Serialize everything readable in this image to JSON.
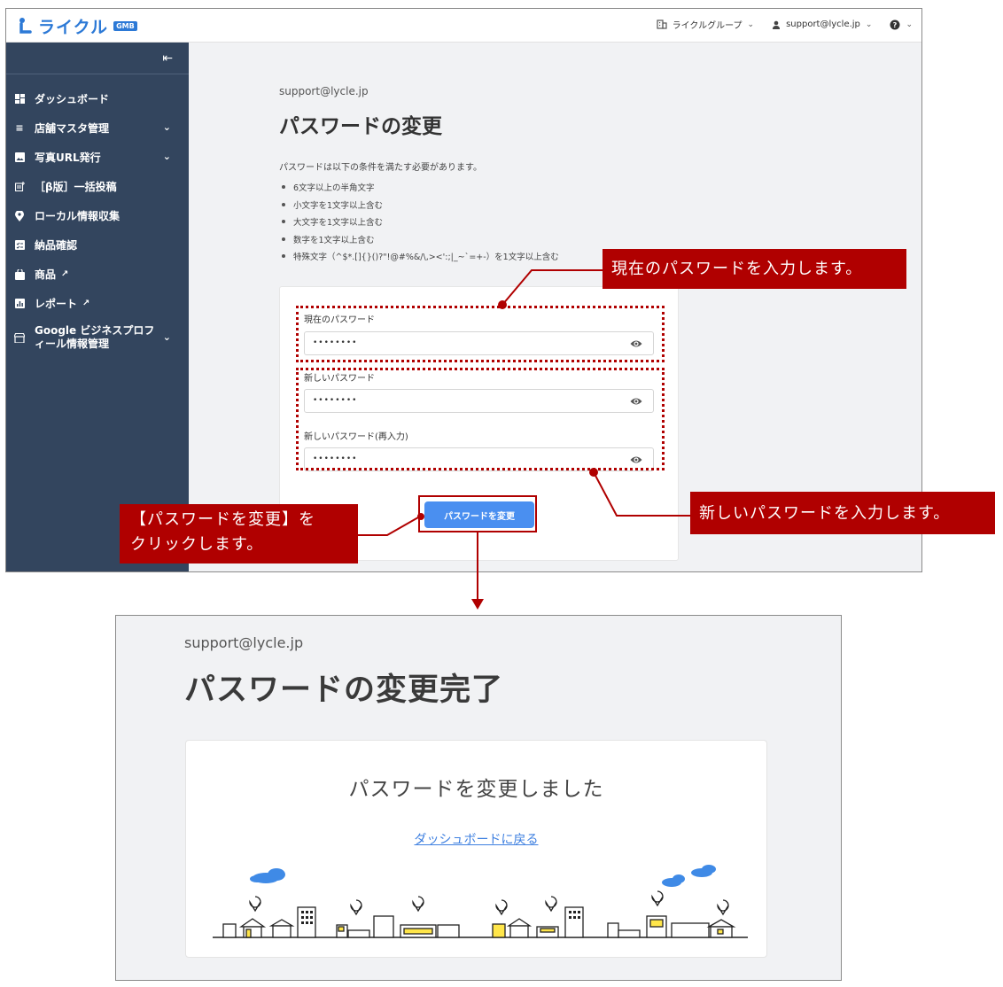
{
  "app": {
    "logo_text": "ライクル",
    "logo_badge": "GMB"
  },
  "topnav": {
    "group": "ライクルグループ",
    "user": "support@lycle.jp",
    "help_icon": "help-icon"
  },
  "sidebar": {
    "collapse_icon": "collapse-left-icon",
    "items": [
      {
        "label": "ダッシュボード",
        "icon": "dashboard-icon",
        "has_chevron": false
      },
      {
        "label": "店舗マスタ管理",
        "icon": "list-icon",
        "has_chevron": true
      },
      {
        "label": "写真URL発行",
        "icon": "image-icon",
        "has_chevron": true
      },
      {
        "label": "［β版］一括投稿",
        "icon": "post-add-icon",
        "has_chevron": false
      },
      {
        "label": "ローカル情報収集",
        "icon": "location-add-icon",
        "has_chevron": false
      },
      {
        "label": "納品確認",
        "icon": "checklist-icon",
        "has_chevron": false
      },
      {
        "label": "商品",
        "icon": "shopping-bag-icon",
        "has_chevron": false,
        "external": true
      },
      {
        "label": "レポート",
        "icon": "bar-chart-icon",
        "has_chevron": false,
        "external": true
      },
      {
        "label_line1": "Google ビジネスプロフ",
        "label_line2": "ィール情報管理",
        "icon": "store-icon",
        "has_chevron": true
      }
    ]
  },
  "page": {
    "email": "support@lycle.jp",
    "title": "パスワードの変更",
    "description": "パスワードは以下の条件を満たす必要があります。",
    "rules": [
      "6文字以上の半角文字",
      "小文字を1文字以上含む",
      "大文字を1文字以上含む",
      "数字を1文字以上含む",
      "特殊文字（^$*.[]{}()?\"!@#%&/\\,><':;|_~`=+-）を1文字以上含む"
    ]
  },
  "form": {
    "current_label": "現在のパスワード",
    "new_label": "新しいパスワード",
    "confirm_label": "新しいパスワード(再入力)",
    "masked_value": "••••••••",
    "submit_label": "パスワードを変更"
  },
  "callouts": {
    "current": "現在のパスワードを入力します。",
    "new": "新しいパスワードを入力します。",
    "click_line1": "【パスワードを変更】を",
    "click_line2": "クリックします。"
  },
  "result": {
    "email": "support@lycle.jp",
    "title": "パスワードの変更完了",
    "message": "パスワードを変更しました",
    "link": "ダッシュボードに戻る"
  },
  "colors": {
    "sidebar_bg": "#33455e",
    "brand_blue": "#2c79d6",
    "button_blue": "#4a8ff0",
    "callout_red": "#b00000",
    "link_blue": "#3d7fe0"
  }
}
